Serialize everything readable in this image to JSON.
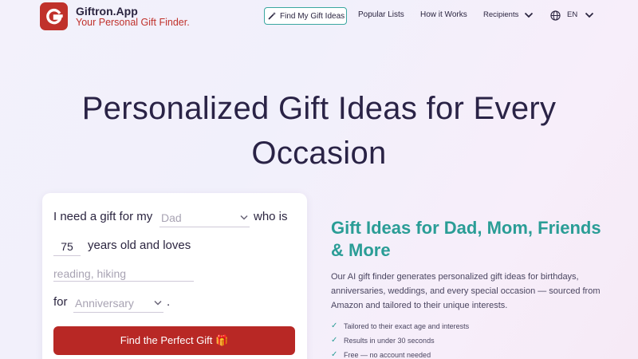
{
  "brand": {
    "logo_letter": "G",
    "name": "Giftron.App",
    "tagline": "Your Personal Gift Finder.",
    "color": "#c0312b"
  },
  "nav": {
    "find_label": "Find My Gift Ideas",
    "popular_label": "Popular Lists",
    "how_label": "How it Works",
    "recipients_label": "Recipients",
    "lang_label": "EN",
    "accent": "#3aa7a0"
  },
  "hero": {
    "title_line1": "Personalized Gift Ideas for Every",
    "title_line2": "Occasion"
  },
  "form": {
    "prefix": "I need a gift for my",
    "recipient_value": "Dad",
    "who_is": "who is",
    "age_value": "75",
    "years_text": "years old and loves",
    "interests_placeholder": "reading, hiking",
    "for_text": "for",
    "occasion_value": "Anniversary",
    "period": ".",
    "cta_label": "Find the Perfect Gift 🎁",
    "cta_color": "#b82825"
  },
  "info": {
    "title": "Gift Ideas for Dad, Mom, Friends & More",
    "description": "Our AI gift finder generates personalized gift ideas for birthdays, anniversaries, weddings, and every special occasion — sourced from Amazon and tailored to their unique interests.",
    "checks": [
      "Tailored to their exact age and interests",
      "Results in under 30 seconds",
      "Free — no account needed"
    ],
    "accent": "#2a9d96"
  }
}
